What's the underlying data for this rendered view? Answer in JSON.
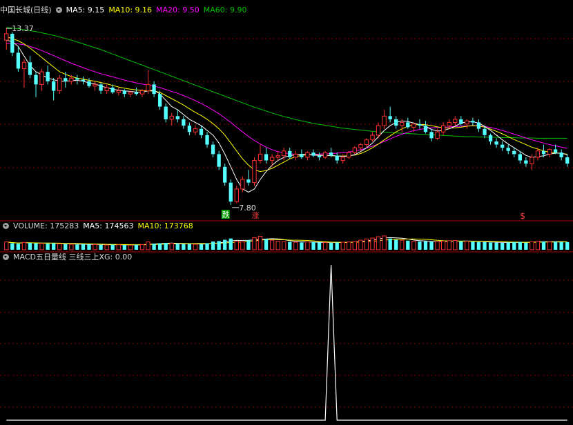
{
  "colors": {
    "background": "#000000",
    "up": "#ff3232",
    "down": "#54ffff",
    "ma5": "#ffffff",
    "ma10": "#ffff00",
    "ma20": "#ff00ff",
    "ma60": "#00c000",
    "grid": "#8b0000",
    "separator": "#b40000",
    "text": "#dcdcdc",
    "signal_die": "#00a000",
    "signal_zhang": "#ff4040"
  },
  "header_main": {
    "title": "中国长城(日线)",
    "ma5": "MA5: 9.15",
    "ma10": "MA10: 9.16",
    "ma20": "MA20: 9.50",
    "ma60": "MA60: 9.90"
  },
  "header_volume": {
    "title": "VOLUME: 175283",
    "ma5": "MA5: 174563",
    "ma10": "MA10: 173768"
  },
  "header_macd": {
    "title": "MACD五日量线 三线三上XG: 0.00"
  },
  "annotations": {
    "high_label": "13.37",
    "low_label": "7.80",
    "signal_die": "跌",
    "signal_zhang": "涨",
    "signal_dollar": "$"
  },
  "chart_data": [
    {
      "type": "candlestick",
      "price_range": [
        7.6,
        13.7
      ],
      "candles": [
        [
          13.0,
          13.37,
          12.7,
          13.2
        ],
        [
          13.2,
          13.25,
          12.5,
          12.6
        ],
        [
          12.6,
          12.8,
          12.0,
          12.1
        ],
        [
          12.1,
          12.4,
          11.5,
          12.3
        ],
        [
          12.3,
          12.5,
          11.8,
          11.9
        ],
        [
          11.9,
          12.0,
          11.2,
          11.6
        ],
        [
          11.6,
          12.1,
          11.4,
          12.0
        ],
        [
          12.0,
          12.2,
          11.6,
          11.7
        ],
        [
          11.7,
          11.8,
          11.1,
          11.4
        ],
        [
          11.4,
          11.9,
          11.3,
          11.8
        ],
        [
          11.8,
          12.0,
          11.5,
          11.7
        ],
        [
          11.7,
          11.9,
          11.6,
          11.8
        ],
        [
          11.8,
          11.9,
          11.6,
          11.75
        ],
        [
          11.75,
          11.85,
          11.6,
          11.7
        ],
        [
          11.7,
          11.8,
          11.5,
          11.55
        ],
        [
          11.55,
          11.7,
          11.4,
          11.6
        ],
        [
          11.6,
          11.65,
          11.3,
          11.4
        ],
        [
          11.4,
          11.6,
          11.3,
          11.5
        ],
        [
          11.5,
          11.6,
          11.3,
          11.35
        ],
        [
          11.35,
          11.5,
          11.25,
          11.4
        ],
        [
          11.4,
          11.45,
          11.2,
          11.3
        ],
        [
          11.3,
          11.4,
          11.2,
          11.35
        ],
        [
          11.35,
          11.5,
          11.25,
          11.3
        ],
        [
          11.3,
          11.45,
          11.2,
          11.4
        ],
        [
          11.4,
          12.05,
          11.3,
          11.6
        ],
        [
          11.6,
          11.7,
          11.2,
          11.3
        ],
        [
          11.3,
          11.4,
          10.8,
          10.9
        ],
        [
          10.9,
          11.0,
          10.4,
          10.5
        ],
        [
          10.5,
          10.7,
          10.3,
          10.6
        ],
        [
          10.6,
          10.8,
          10.4,
          10.5
        ],
        [
          10.5,
          10.6,
          10.2,
          10.3
        ],
        [
          10.3,
          10.4,
          10.0,
          10.1
        ],
        [
          10.1,
          10.3,
          10.0,
          10.2
        ],
        [
          10.2,
          10.3,
          9.9,
          10.0
        ],
        [
          10.0,
          10.1,
          9.6,
          9.7
        ],
        [
          9.7,
          9.8,
          9.3,
          9.4
        ],
        [
          9.4,
          9.5,
          8.9,
          9.0
        ],
        [
          9.0,
          9.1,
          8.4,
          8.5
        ],
        [
          8.5,
          8.6,
          7.8,
          7.9
        ],
        [
          7.9,
          8.4,
          7.85,
          8.3
        ],
        [
          8.3,
          8.7,
          8.2,
          8.6
        ],
        [
          8.6,
          8.9,
          8.4,
          8.5
        ],
        [
          8.5,
          9.3,
          8.4,
          9.2
        ],
        [
          9.2,
          9.7,
          9.1,
          9.4
        ],
        [
          9.4,
          9.6,
          9.1,
          9.2
        ],
        [
          9.2,
          9.4,
          9.0,
          9.3
        ],
        [
          9.3,
          9.5,
          9.2,
          9.35
        ],
        [
          9.35,
          9.6,
          9.2,
          9.5
        ],
        [
          9.5,
          9.6,
          9.25,
          9.3
        ],
        [
          9.3,
          9.5,
          9.2,
          9.4
        ],
        [
          9.4,
          9.55,
          9.25,
          9.3
        ],
        [
          9.3,
          9.5,
          9.2,
          9.45
        ],
        [
          9.45,
          9.55,
          9.3,
          9.35
        ],
        [
          9.35,
          9.45,
          9.2,
          9.3
        ],
        [
          9.3,
          9.5,
          9.25,
          9.45
        ],
        [
          9.45,
          9.6,
          9.3,
          9.35
        ],
        [
          9.35,
          9.45,
          9.1,
          9.2
        ],
        [
          9.2,
          9.4,
          9.1,
          9.3
        ],
        [
          9.3,
          9.5,
          9.25,
          9.45
        ],
        [
          9.45,
          9.65,
          9.4,
          9.6
        ],
        [
          9.6,
          9.75,
          9.5,
          9.7
        ],
        [
          9.7,
          9.9,
          9.6,
          9.85
        ],
        [
          9.85,
          10.1,
          9.8,
          10.0
        ],
        [
          10.0,
          10.4,
          9.9,
          10.3
        ],
        [
          10.3,
          10.8,
          10.2,
          10.6
        ],
        [
          10.6,
          10.9,
          10.4,
          10.5
        ],
        [
          10.5,
          10.6,
          10.2,
          10.3
        ],
        [
          10.3,
          10.5,
          10.1,
          10.4
        ],
        [
          10.4,
          10.55,
          10.2,
          10.25
        ],
        [
          10.25,
          10.4,
          10.1,
          10.35
        ],
        [
          10.35,
          10.5,
          10.2,
          10.3
        ],
        [
          10.3,
          10.45,
          10.05,
          10.1
        ],
        [
          10.1,
          10.2,
          9.8,
          9.9
        ],
        [
          9.9,
          10.2,
          9.85,
          10.1
        ],
        [
          10.1,
          10.4,
          10.0,
          10.3
        ],
        [
          10.3,
          10.5,
          10.2,
          10.4
        ],
        [
          10.4,
          10.6,
          10.3,
          10.5
        ],
        [
          10.5,
          10.6,
          10.3,
          10.35
        ],
        [
          10.35,
          10.5,
          10.2,
          10.45
        ],
        [
          10.45,
          10.55,
          10.3,
          10.4
        ],
        [
          10.4,
          10.5,
          10.1,
          10.2
        ],
        [
          10.2,
          10.3,
          9.9,
          10.0
        ],
        [
          10.0,
          10.05,
          9.7,
          9.8
        ],
        [
          9.8,
          9.9,
          9.6,
          9.7
        ],
        [
          9.7,
          9.8,
          9.5,
          9.6
        ],
        [
          9.6,
          9.7,
          9.4,
          9.5
        ],
        [
          9.5,
          9.6,
          9.3,
          9.4
        ],
        [
          9.4,
          9.5,
          9.1,
          9.2
        ],
        [
          9.2,
          9.3,
          9.0,
          9.1
        ],
        [
          9.1,
          9.4,
          8.9,
          9.3
        ],
        [
          9.3,
          9.6,
          9.2,
          9.5
        ],
        [
          9.5,
          9.7,
          9.3,
          9.4
        ],
        [
          9.4,
          9.6,
          9.3,
          9.55
        ],
        [
          9.55,
          9.7,
          9.4,
          9.45
        ],
        [
          9.45,
          9.55,
          9.2,
          9.3
        ],
        [
          9.3,
          9.4,
          9.0,
          9.1
        ]
      ],
      "ma5": [
        13.0,
        12.95,
        12.8,
        12.5,
        12.2,
        12.0,
        11.9,
        11.8,
        11.75,
        11.7,
        11.7,
        11.72,
        11.73,
        11.7,
        11.65,
        11.62,
        11.55,
        11.5,
        11.45,
        11.42,
        11.4,
        11.38,
        11.36,
        11.35,
        11.4,
        11.42,
        11.3,
        11.1,
        10.9,
        10.8,
        10.65,
        10.5,
        10.4,
        10.3,
        10.15,
        10.0,
        9.75,
        9.4,
        9.0,
        8.6,
        8.3,
        8.2,
        8.3,
        8.6,
        8.85,
        9.05,
        9.2,
        9.3,
        9.35,
        9.38,
        9.4,
        9.38,
        9.37,
        9.36,
        9.36,
        9.36,
        9.34,
        9.33,
        9.34,
        9.38,
        9.48,
        9.6,
        9.75,
        9.95,
        10.15,
        10.3,
        10.4,
        10.45,
        10.43,
        10.38,
        10.33,
        10.28,
        10.18,
        10.13,
        10.15,
        10.2,
        10.28,
        10.38,
        10.42,
        10.42,
        10.38,
        10.28,
        10.15,
        10.0,
        9.85,
        9.72,
        9.6,
        9.48,
        9.36,
        9.3,
        9.32,
        9.35,
        9.4,
        9.43,
        9.43,
        9.38
      ],
      "ma10": [
        13.1,
        13.05,
        12.98,
        12.88,
        12.75,
        12.6,
        12.45,
        12.3,
        12.15,
        12.0,
        11.92,
        11.85,
        11.8,
        11.77,
        11.73,
        11.7,
        11.66,
        11.62,
        11.57,
        11.52,
        11.48,
        11.45,
        11.43,
        11.41,
        11.4,
        11.39,
        11.35,
        11.25,
        11.15,
        11.05,
        10.95,
        10.83,
        10.72,
        10.62,
        10.5,
        10.36,
        10.2,
        10.0,
        9.75,
        9.5,
        9.25,
        9.05,
        8.9,
        8.85,
        8.88,
        8.95,
        9.05,
        9.15,
        9.25,
        9.32,
        9.36,
        9.38,
        9.38,
        9.37,
        9.36,
        9.35,
        9.34,
        9.34,
        9.35,
        9.37,
        9.42,
        9.5,
        9.6,
        9.72,
        9.85,
        9.98,
        10.1,
        10.2,
        10.28,
        10.32,
        10.34,
        10.33,
        10.3,
        10.26,
        10.23,
        10.22,
        10.23,
        10.25,
        10.28,
        10.3,
        10.29,
        10.25,
        10.19,
        10.12,
        10.04,
        9.95,
        9.86,
        9.78,
        9.7,
        9.62,
        9.56,
        9.5,
        9.46,
        9.44,
        9.42,
        9.4
      ],
      "ma20": [
        12.9,
        12.9,
        12.88,
        12.85,
        12.8,
        12.74,
        12.67,
        12.59,
        12.51,
        12.43,
        12.35,
        12.27,
        12.2,
        12.13,
        12.06,
        12.0,
        11.94,
        11.89,
        11.84,
        11.79,
        11.74,
        11.69,
        11.65,
        11.61,
        11.58,
        11.55,
        11.5,
        11.44,
        11.38,
        11.32,
        11.25,
        11.17,
        11.09,
        11.0,
        10.9,
        10.79,
        10.67,
        10.54,
        10.4,
        10.25,
        10.1,
        9.96,
        9.83,
        9.72,
        9.62,
        9.54,
        9.48,
        9.44,
        9.41,
        9.39,
        9.38,
        9.38,
        9.39,
        9.4,
        9.41,
        9.42,
        9.43,
        9.45,
        9.47,
        9.5,
        9.54,
        9.59,
        9.65,
        9.72,
        9.8,
        9.88,
        9.96,
        10.03,
        10.09,
        10.14,
        10.18,
        10.21,
        10.23,
        10.24,
        10.25,
        10.26,
        10.27,
        10.28,
        10.29,
        10.3,
        10.29,
        10.27,
        10.24,
        10.2,
        10.15,
        10.09,
        10.03,
        9.97,
        9.91,
        9.85,
        9.8,
        9.75,
        9.7,
        9.66,
        9.62,
        9.58
      ],
      "ma60": [
        13.4,
        13.38,
        13.36,
        13.33,
        13.3,
        13.27,
        13.23,
        13.19,
        13.15,
        13.1,
        13.05,
        13.0,
        12.94,
        12.88,
        12.82,
        12.76,
        12.7,
        12.63,
        12.56,
        12.49,
        12.42,
        12.35,
        12.28,
        12.21,
        12.14,
        12.07,
        12.0,
        11.93,
        11.86,
        11.79,
        11.72,
        11.65,
        11.58,
        11.51,
        11.44,
        11.37,
        11.3,
        11.23,
        11.16,
        11.09,
        11.02,
        10.95,
        10.88,
        10.82,
        10.76,
        10.7,
        10.64,
        10.59,
        10.54,
        10.49,
        10.45,
        10.41,
        10.37,
        10.34,
        10.31,
        10.28,
        10.25,
        10.22,
        10.2,
        10.18,
        10.16,
        10.14,
        10.12,
        10.1,
        10.09,
        10.08,
        10.07,
        10.06,
        10.05,
        10.04,
        10.03,
        10.02,
        10.01,
        10.0,
        9.99,
        9.98,
        9.97,
        9.96,
        9.95,
        9.95,
        9.94,
        9.94,
        9.93,
        9.93,
        9.92,
        9.92,
        9.92,
        9.91,
        9.91,
        9.91,
        9.9,
        9.9,
        9.9,
        9.9,
        9.9,
        9.9
      ]
    },
    {
      "type": "bar",
      "name": "VOLUME",
      "volume_max": 350000,
      "values": [
        180000,
        150000,
        140000,
        170000,
        160000,
        150000,
        145000,
        140000,
        150000,
        135000,
        130000,
        125000,
        120000,
        130000,
        125000,
        120000,
        115000,
        110000,
        120000,
        115000,
        110000,
        105000,
        115000,
        120000,
        180000,
        140000,
        150000,
        160000,
        150000,
        140000,
        130000,
        135000,
        125000,
        130000,
        150000,
        190000,
        200000,
        230000,
        260000,
        200000,
        180000,
        220000,
        280000,
        310000,
        250000,
        220000,
        200000,
        190000,
        180000,
        175000,
        170000,
        180000,
        175000,
        170000,
        165000,
        160000,
        170000,
        175000,
        180000,
        190000,
        220000,
        250000,
        270000,
        300000,
        320000,
        260000,
        230000,
        220000,
        210000,
        200000,
        190000,
        195000,
        185000,
        190000,
        200000,
        210000,
        215000,
        190000,
        195000,
        185000,
        180000,
        175000,
        170000,
        165000,
        160000,
        170000,
        175000,
        180000,
        165000,
        185000,
        200000,
        190000,
        180000,
        185000,
        175000,
        175283
      ]
    },
    {
      "type": "line",
      "name": "三线三上XG",
      "ylim": [
        0,
        1
      ],
      "values": [
        0,
        0,
        0,
        0,
        0,
        0,
        0,
        0,
        0,
        0,
        0,
        0,
        0,
        0,
        0,
        0,
        0,
        0,
        0,
        0,
        0,
        0,
        0,
        0,
        0,
        0,
        0,
        0,
        0,
        0,
        0,
        0,
        0,
        0,
        0,
        0,
        0,
        0,
        0,
        0,
        0,
        0,
        0,
        0,
        0,
        0,
        0,
        0,
        0,
        0,
        0,
        0,
        0,
        0,
        0,
        1,
        0,
        0,
        0,
        0,
        0,
        0,
        0,
        0,
        0,
        0,
        0,
        0,
        0,
        0,
        0,
        0,
        0,
        0,
        0,
        0,
        0,
        0,
        0,
        0,
        0,
        0,
        0,
        0,
        0,
        0,
        0,
        0,
        0,
        0,
        0,
        0,
        0,
        0,
        0,
        0
      ]
    }
  ]
}
